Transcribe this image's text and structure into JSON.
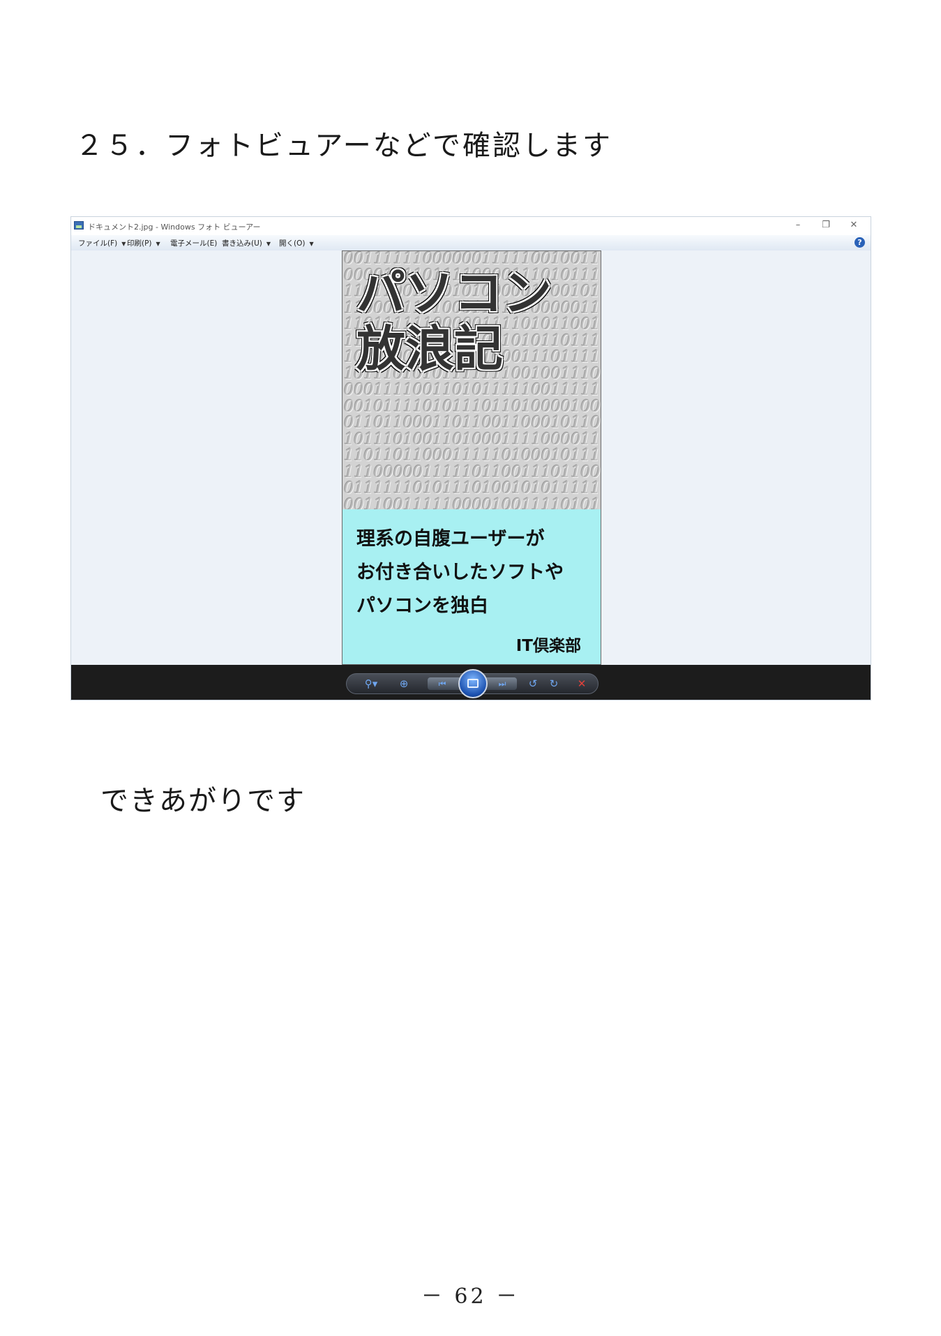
{
  "heading": "２５．フォトビュアーなどで確認します",
  "window": {
    "title": "ドキュメント2.jpg - Windows フォト ビューアー",
    "minimize_glyph": "–",
    "restore_glyph": "❐",
    "close_glyph": "✕",
    "menu": [
      {
        "label": "ファイル(F)",
        "has_dropdown": true
      },
      {
        "label": "印刷(P)",
        "has_dropdown": true
      },
      {
        "label": "電子メール(E)",
        "has_dropdown": false
      },
      {
        "label": "書き込み(U)",
        "has_dropdown": true
      },
      {
        "label": "開く(O)",
        "has_dropdown": true
      }
    ],
    "help_glyph": "?",
    "image": {
      "title_lines": [
        "パソコン",
        "放浪記"
      ],
      "binary_pattern": "001111110000001111100100110000111101111000011101011111011001110101000001100101110001110100011111100000111101111110000011110101100111011101000101001010110111101010000101111000111011111011101010111111100100111000011110011010111110011111001011110101110110100001000110110001101100110001011010111010011010001111000011110110110001111101000101111110000011111011001110110001111110101110100101011111001100111110000100111101010011101110001100111111011000011100111111000010011000001111001101000001011111110000011111011100101111101001111110011110000000010111011111011000001110001011111000011001111101010000010110110011111100110000111101110111011001010010000111111100000111101110",
      "subtitle_lines": [
        "理系の自腹ユーザーが",
        "お付き合いしたソフトや",
        "パソコンを独白"
      ],
      "publisher": "IT倶楽部"
    },
    "controls": {
      "zoom_glyph": "⚲▾",
      "fit_glyph": "⊕",
      "previous_glyph": "⏮",
      "next_glyph": "⏭",
      "rotate_ccw_glyph": "↺",
      "rotate_cw_glyph": "↻",
      "delete_glyph": "✕"
    }
  },
  "body_text": "できあがりです",
  "page_number": "－ 62 －",
  "colors": {
    "cover_bottom": "#a8f0f2",
    "control_bar": "#1c1c1c",
    "viewer_background": "#edf2f8"
  }
}
